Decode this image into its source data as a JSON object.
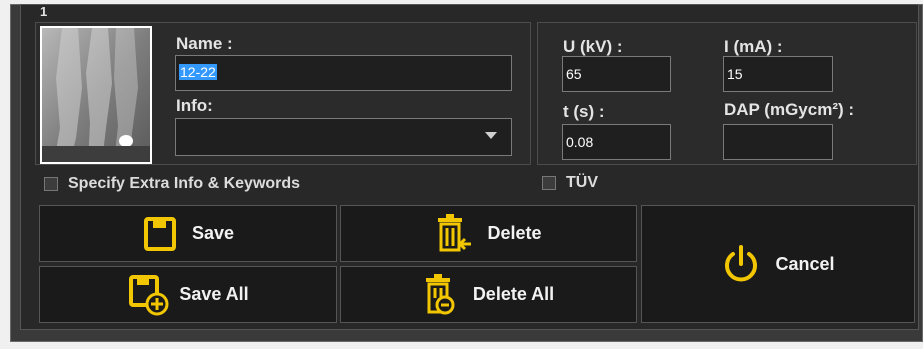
{
  "dialog": {
    "index_label": "1"
  },
  "thumbnail": {
    "icon": "dental-xray-image"
  },
  "name_field": {
    "label": "Name :",
    "value": "12-22"
  },
  "info_field": {
    "label": "Info:",
    "value": ""
  },
  "exposure": {
    "u_label": "U (kV) :",
    "u_value": "65",
    "i_label": "I (mA) :",
    "i_value": "15",
    "t_label": "t (s) :",
    "t_value": "0.08",
    "dap_label": "DAP (mGycm²) :",
    "dap_value": ""
  },
  "options": {
    "extra_info_label": "Specify Extra Info & Keywords",
    "tuv_label": "TÜV"
  },
  "buttons": {
    "save": "Save",
    "save_all": "Save All",
    "delete": "Delete",
    "delete_all": "Delete All",
    "cancel": "Cancel"
  },
  "colors": {
    "accent": "#f2c600",
    "selection": "#3399ff",
    "background": "#282828"
  }
}
